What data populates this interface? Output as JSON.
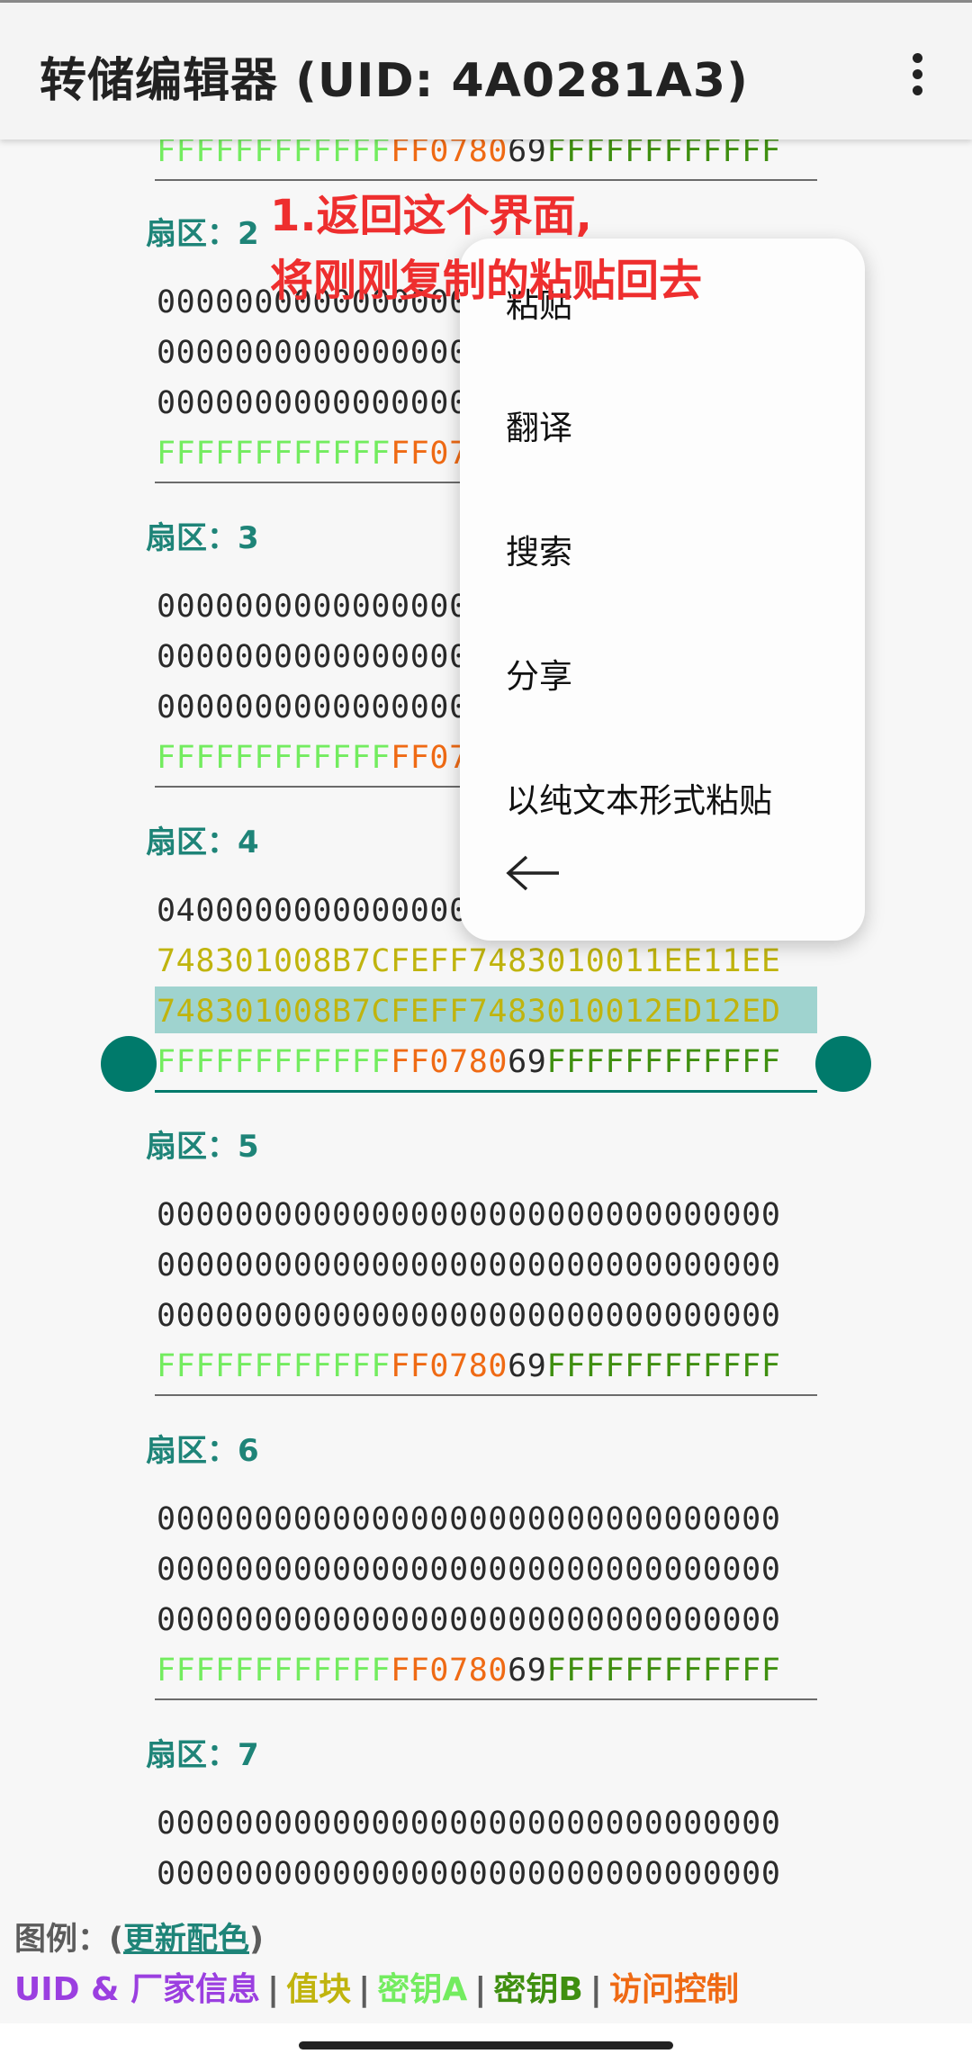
{
  "app_bar": {
    "title": "转储编辑器 (UID: 4A0281A3)",
    "more_icon": "more-vert-icon"
  },
  "sectors": [
    {
      "label": "扇区：2",
      "rows": [
        {
          "segments": [
            {
              "t": "00000000000000000000000000000000",
              "c": "zero"
            }
          ]
        },
        {
          "segments": [
            {
              "t": "00000000000000000000000000000000",
              "c": "zero"
            }
          ]
        },
        {
          "segments": [
            {
              "t": "00000000000000000000000000000000",
              "c": "zero"
            }
          ]
        },
        {
          "segments": [
            {
              "t": "FFFFFFFFFFFF",
              "c": "ka"
            },
            {
              "t": "FF0780",
              "c": "ac"
            },
            {
              "t": "69",
              "c": "uid"
            },
            {
              "t": "FFFFFFFFFFFF",
              "c": "kb"
            }
          ]
        }
      ]
    },
    {
      "label": "扇区：3",
      "rows": [
        {
          "segments": [
            {
              "t": "00000000000000000000000000000000",
              "c": "zero"
            }
          ]
        },
        {
          "segments": [
            {
              "t": "00000000000000000000000000000000",
              "c": "zero"
            }
          ]
        },
        {
          "segments": [
            {
              "t": "00000000000000000000000000000000",
              "c": "zero"
            }
          ]
        },
        {
          "segments": [
            {
              "t": "FFFFFFFFFFFF",
              "c": "ka"
            },
            {
              "t": "FF0780",
              "c": "ac"
            },
            {
              "t": "69",
              "c": "uid"
            },
            {
              "t": "FFFFFFFFFFFF",
              "c": "kb"
            }
          ]
        }
      ]
    },
    {
      "label": "扇区：4",
      "rows": [
        {
          "segments": [
            {
              "t": "04000000000000000000000000000000",
              "c": "zero"
            }
          ]
        },
        {
          "segments": [
            {
              "t": "748301008B7CFEFF7483010011EE11EE",
              "c": "v"
            }
          ]
        },
        {
          "segments": [
            {
              "t": "748301008B7CFEFF7483010012ED12ED",
              "c": "v"
            }
          ]
        },
        {
          "segments": [
            {
              "t": "FFFFFFFFFFFF",
              "c": "ka"
            },
            {
              "t": "FF0780",
              "c": "ac"
            },
            {
              "t": "69",
              "c": "uid"
            },
            {
              "t": "FFFFFFFFFFFF",
              "c": "kb"
            }
          ]
        }
      ]
    },
    {
      "label": "扇区：5",
      "rows": [
        {
          "segments": [
            {
              "t": "00000000000000000000000000000000",
              "c": "zero"
            }
          ]
        },
        {
          "segments": [
            {
              "t": "00000000000000000000000000000000",
              "c": "zero"
            }
          ]
        },
        {
          "segments": [
            {
              "t": "00000000000000000000000000000000",
              "c": "zero"
            }
          ]
        },
        {
          "segments": [
            {
              "t": "FFFFFFFFFFFF",
              "c": "ka"
            },
            {
              "t": "FF0780",
              "c": "ac"
            },
            {
              "t": "69",
              "c": "uid"
            },
            {
              "t": "FFFFFFFFFFFF",
              "c": "kb"
            }
          ]
        }
      ]
    },
    {
      "label": "扇区：6",
      "rows": [
        {
          "segments": [
            {
              "t": "00000000000000000000000000000000",
              "c": "zero"
            }
          ]
        },
        {
          "segments": [
            {
              "t": "00000000000000000000000000000000",
              "c": "zero"
            }
          ]
        },
        {
          "segments": [
            {
              "t": "00000000000000000000000000000000",
              "c": "zero"
            }
          ]
        },
        {
          "segments": [
            {
              "t": "FFFFFFFFFFFF",
              "c": "ka"
            },
            {
              "t": "FF0780",
              "c": "ac"
            },
            {
              "t": "69",
              "c": "uid"
            },
            {
              "t": "FFFFFFFFFFFF",
              "c": "kb"
            }
          ]
        }
      ]
    },
    {
      "label": "扇区：7",
      "rows": [
        {
          "segments": [
            {
              "t": "00000000000000000000000000000000",
              "c": "zero"
            }
          ]
        },
        {
          "segments": [
            {
              "t": "00000000000000000000000000000000",
              "c": "zero"
            }
          ]
        }
      ]
    }
  ],
  "prev_sector_tail": {
    "segments": [
      {
        "t": "FFFFFFFFFFFF",
        "c": "ka"
      },
      {
        "t": "FF0780",
        "c": "ac"
      },
      {
        "t": "69",
        "c": "uid"
      },
      {
        "t": "FFFFFFFFFFFF",
        "c": "kb"
      }
    ]
  },
  "context_menu": {
    "items": [
      "粘贴",
      "翻译",
      "搜索",
      "分享",
      "以纯文本形式粘贴"
    ],
    "back_icon": "arrow-left-icon"
  },
  "annotation": {
    "line1": "1.返回这个界面,",
    "line2": "将刚刚复制的粘贴回去"
  },
  "legend": {
    "prefix": "图例：(",
    "link": "更新配色",
    "suffix": ")",
    "items": [
      {
        "label": "UID & 厂家信息",
        "color": "#9b3fe0"
      },
      {
        "label": "值块",
        "color": "#c0b40e"
      },
      {
        "label": "密钥A",
        "color": "#73ec5f"
      },
      {
        "label": "密钥B",
        "color": "#3f8f10"
      },
      {
        "label": "访问控制",
        "color": "#ef6a14"
      }
    ],
    "separator": "|"
  }
}
